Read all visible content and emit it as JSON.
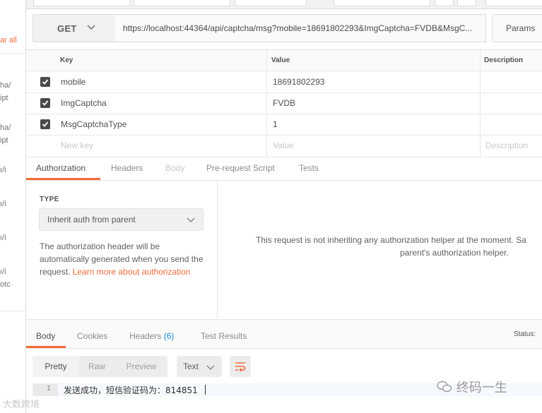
{
  "sidebar": {
    "clear_all": "ar all",
    "fragments": [
      "ha/",
      "ipt",
      "ha/",
      "ipt",
      "ı/i",
      "ı/i",
      "ı/i",
      "ı/i",
      "otc"
    ]
  },
  "request": {
    "method": "GET",
    "url": "https://localhost:44364/api/captcha/msg?mobile=18691802293&ImgCaptcha=FVDB&MsgC...",
    "params_label": "Params"
  },
  "params_table": {
    "headers": {
      "key": "Key",
      "value": "Value",
      "description": "Description"
    },
    "rows": [
      {
        "key": "mobile",
        "value": "18691802293"
      },
      {
        "key": "ImgCaptcha",
        "value": "FVDB"
      },
      {
        "key": "MsgCaptchaType",
        "value": "1"
      }
    ],
    "placeholders": {
      "key": "New key",
      "value": "Value",
      "description": "Description"
    }
  },
  "request_tabs": [
    "Authorization",
    "Headers",
    "Body",
    "Pre-request Script",
    "Tests"
  ],
  "auth": {
    "type_label": "TYPE",
    "type_value": "Inherit auth from parent",
    "description": "The authorization header will be automatically generated when you send the request.",
    "learn_more": "Learn more about authorization",
    "message_line1": "This request is not inheriting any authorization helper at the moment. Sa",
    "message_line2": "parent's authorization helper."
  },
  "response_tabs": {
    "body": "Body",
    "cookies": "Cookies",
    "headers": "Headers",
    "headers_count": "(6)",
    "test_results": "Test Results",
    "status_label": "Status:"
  },
  "response_toolbar": {
    "formats": [
      "Pretty",
      "Raw",
      "Preview"
    ],
    "type_select": "Text"
  },
  "response_body": {
    "line_number": "1",
    "text": "发送成功，短信验证码为：814851"
  },
  "watermarks": {
    "right": "终码一生",
    "left": "大数跨境"
  },
  "colors": {
    "accent": "#f26b3a",
    "count": "#1b87d6"
  }
}
